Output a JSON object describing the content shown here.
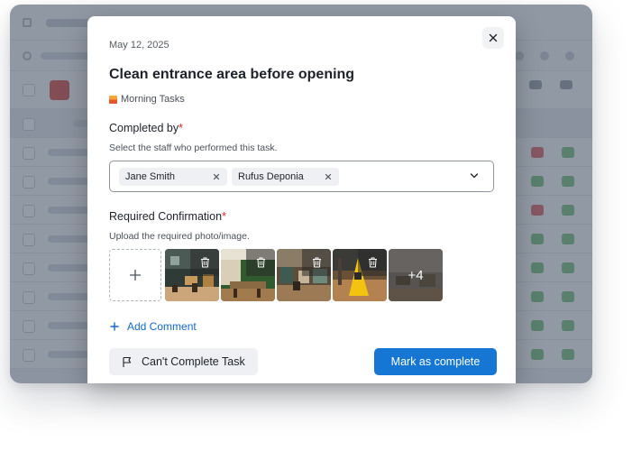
{
  "modal": {
    "date": "May 12, 2025",
    "title": "Clean entrance area before opening",
    "category": "Morning Tasks",
    "completed_by": {
      "label": "Completed by",
      "required_mark": "*",
      "hint": "Select the staff who performed this task.",
      "selected": [
        {
          "name": "Jane Smith"
        },
        {
          "name": "Rufus Deponia"
        }
      ]
    },
    "confirmation": {
      "label": "Required Confirmation",
      "required_mark": "*",
      "hint": "Upload the required photo/image.",
      "more_count": "+4"
    },
    "add_comment_label": "Add Comment",
    "cant_complete_label": "Can't Complete Task",
    "mark_complete_label": "Mark as complete"
  },
  "icons": {
    "close": "close-icon",
    "remove_chip": "close-icon",
    "dropdown": "chevron-down-icon",
    "upload": "plus-icon",
    "delete": "trash-icon",
    "comment": "plus-icon",
    "flag": "flag-icon"
  },
  "colors": {
    "primary": "#1576d3",
    "link": "#1468c8",
    "required": "#d22b2b"
  }
}
